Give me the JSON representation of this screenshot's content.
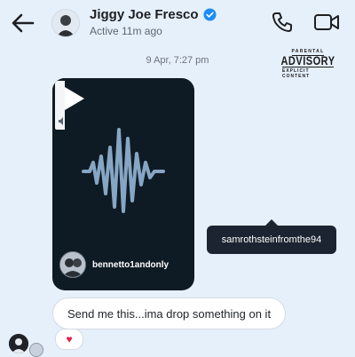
{
  "header": {
    "contact_name": "Jiggy Joe Fresco",
    "status": "Active 11m ago",
    "icons": {
      "back": "back-arrow-icon",
      "verified": "verified-badge-icon",
      "call": "phone-icon",
      "video": "video-camera-icon"
    }
  },
  "parental_advisory": {
    "top": "PARENTAL",
    "middle": "ADVISORY",
    "bottom": "EXPLICIT CONTENT"
  },
  "conversation": {
    "timestamp": "9 Apr, 7:27 pm",
    "voice_message": {
      "username": "bennetto1andonly"
    },
    "tooltip_text": "samrothsteinfromthe94",
    "text_message": "Send me this...ima drop something on it",
    "reaction": "♥"
  },
  "colors": {
    "background": "#e6f0fb",
    "card": "#0f1b24",
    "waveform": "#86a6c4",
    "verified": "#1d8cf8",
    "reaction_heart": "#e11d48"
  }
}
